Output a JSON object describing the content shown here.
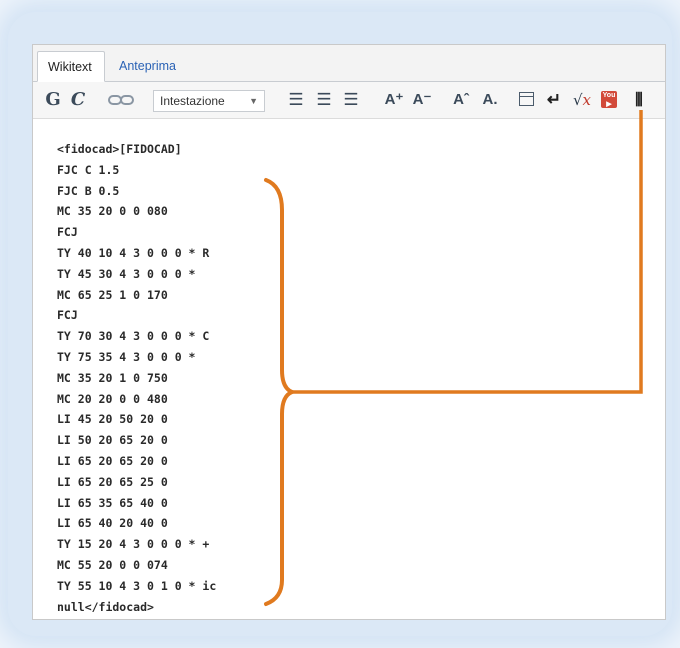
{
  "tabs": {
    "wikitext": "Wikitext",
    "preview": "Anteprima"
  },
  "toolbar": {
    "bold": "G",
    "italic": "C",
    "link_icon": "link-icon",
    "heading_select": "Intestazione",
    "bullet_list": "☰",
    "numbered_list": "☰",
    "indent": "☰",
    "big": "A⁺",
    "small": "A⁻",
    "superscript": "Aˆ",
    "subscript": "A.",
    "newline": "↵",
    "math_radical": "√",
    "math_var": "x",
    "fidocad": "⦀"
  },
  "editor": {
    "lines": [
      "<fidocad>[FIDOCAD]",
      "FJC C 1.5",
      "FJC B 0.5",
      "MC 35 20 0 0 080",
      "FCJ",
      "TY 40 10 4 3 0 0 0 * R",
      "TY 45 30 4 3 0 0 0 *",
      "MC 65 25 1 0 170",
      "FCJ",
      "TY 70 30 4 3 0 0 0 * C",
      "TY 75 35 4 3 0 0 0 *",
      "MC 35 20 1 0 750",
      "MC 20 20 0 0 480",
      "LI 45 20 50 20 0",
      "LI 50 20 65 20 0",
      "LI 65 20 65 20 0",
      "LI 65 20 65 25 0",
      "LI 65 35 65 40 0",
      "LI 65 40 20 40 0",
      "TY 15 20 4 3 0 0 0 * +",
      "MC 55 20 0 0 074",
      "TY 55 10 4 3 0 1 0 * ic",
      "null</fidocad>"
    ]
  },
  "annotation": {
    "color": "#e07a1f"
  }
}
